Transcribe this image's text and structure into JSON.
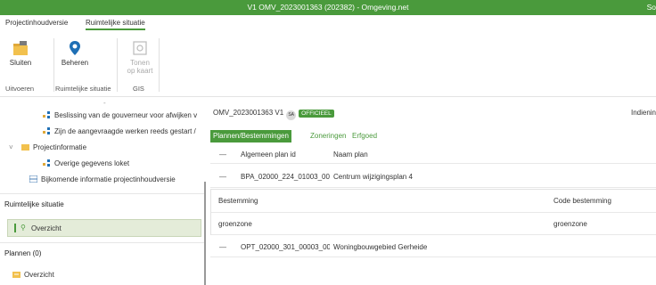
{
  "titlebar": {
    "title": "V1 OMV_2023001363 (202382) - Omgeving.net",
    "user": "So"
  },
  "ribbon_tabs": [
    "Projectinhoudversie",
    "Ruimtelijke situatie"
  ],
  "ribbon": {
    "close_label": "Sluiten",
    "manage_label": "Beheren",
    "map_label_1": "Tonen",
    "map_label_2": "op kaart",
    "groups": [
      "Uitvoeren",
      "Ruimtelijke situatie",
      "GIS"
    ]
  },
  "tree": {
    "caret": "-",
    "item1": "Beslissing van de gouverneur voor afwijken v",
    "item2": "Zijn de aangevraagde werken reeds gestart /",
    "folder": "Projectinformatie",
    "item3": "Overige gegevens loket",
    "item4": "Bijkomende informatie projectinhoudversie"
  },
  "sections": {
    "ruimtelijke": "Ruimtelijke situatie",
    "overview1": "Overzicht",
    "plannen": "Plannen (0)",
    "overview2": "Overzicht"
  },
  "main": {
    "dossier": "OMV_2023001363 V1",
    "badge_sa": "SA",
    "badge_status": "OFFICIEEL",
    "indiening": "Indienin"
  },
  "tabs": [
    "Plannen/Bestemmingen",
    "Zoneringen",
    "Erfgoed"
  ],
  "plan_table": {
    "headers": [
      "Algemeen plan id",
      "Naam plan"
    ],
    "rows": [
      {
        "toggle": "—",
        "id": "BPA_02000_224_01003_00(",
        "name": "Centrum wijzigingsplan 4"
      },
      {
        "toggle": "—",
        "id": "OPT_02000_301_00003_00(",
        "name": "Woningbouwgebied Gerheide"
      }
    ]
  },
  "dest_table": {
    "headers": [
      "Bestemming",
      "Code bestemming"
    ],
    "rows": [
      {
        "bestemming": "groenzone",
        "code": "groenzone"
      }
    ]
  },
  "colors": {
    "accent": "#4a9a3c"
  }
}
